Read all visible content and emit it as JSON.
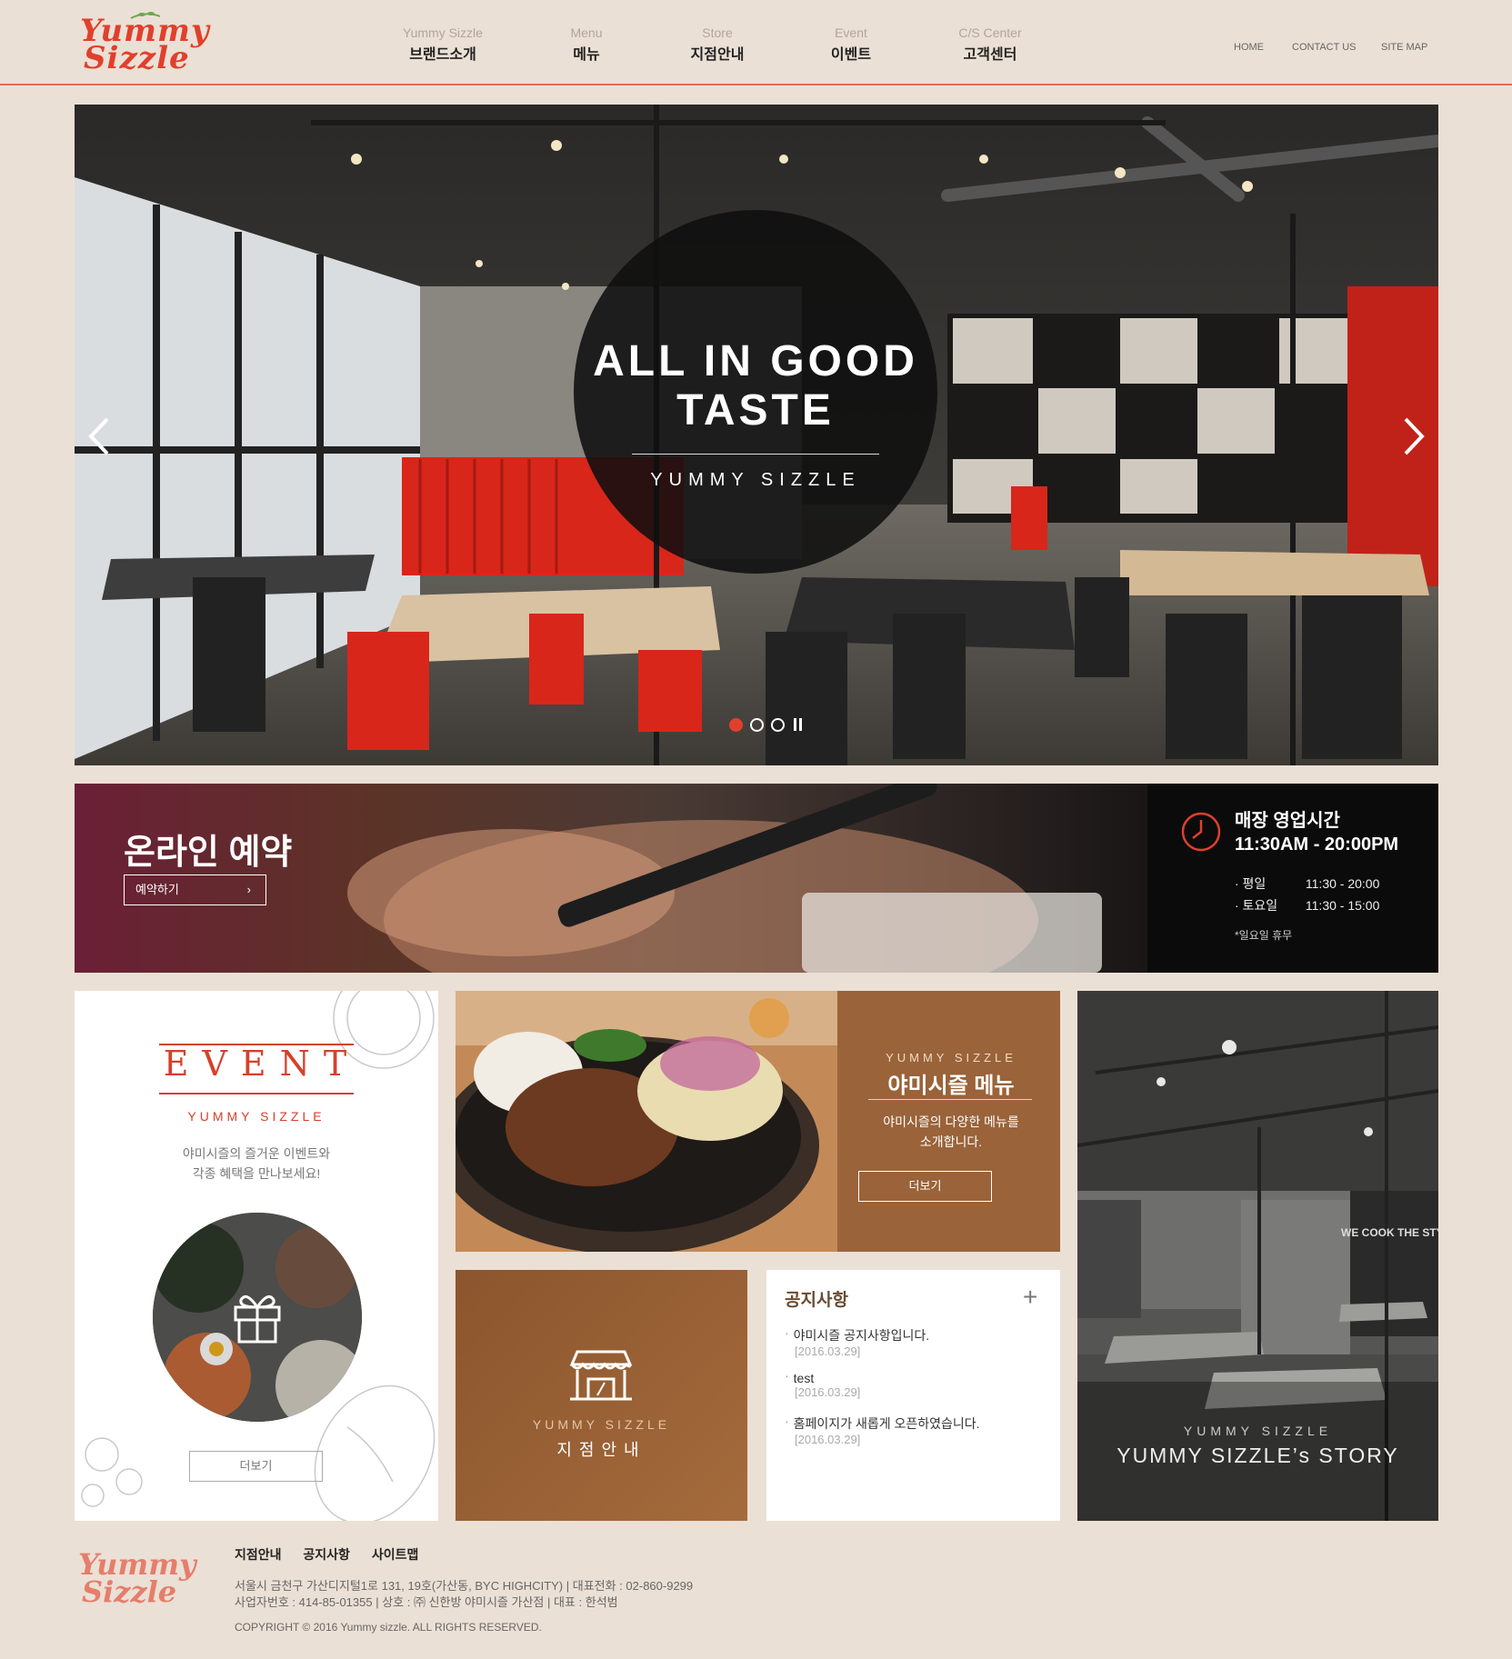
{
  "header": {
    "logo_line1": "Yummy",
    "logo_line2": "Sizzle",
    "nav": [
      {
        "en": "Yummy Sizzle",
        "ko": "브랜드소개"
      },
      {
        "en": "Menu",
        "ko": "메뉴"
      },
      {
        "en": "Store",
        "ko": "지점안내"
      },
      {
        "en": "Event",
        "ko": "이벤트"
      },
      {
        "en": "C/S Center",
        "ko": "고객센터"
      }
    ],
    "util": [
      "HOME",
      "CONTACT US",
      "SITE MAP"
    ]
  },
  "hero": {
    "title_line1": "ALL IN GOOD",
    "title_line2": "TASTE",
    "subtitle": "YUMMY SIZZLE",
    "slide_count": 3,
    "active_slide": 1
  },
  "reservation": {
    "title": "온라인 예약",
    "button": "예약하기",
    "chevron": "›",
    "hours_title": "매장 영업시간",
    "hours_range": "11:30AM - 20:00PM",
    "rows": [
      {
        "day": "· 평일",
        "time": "11:30 - 20:00"
      },
      {
        "day": "· 토요일",
        "time": "11:30 - 15:00"
      }
    ],
    "note": "*일요일 휴무"
  },
  "event": {
    "title": "EVENT",
    "subtitle": "YUMMY SIZZLE",
    "desc_line1": "야미시즐의 즐거운 이벤트와",
    "desc_line2": "각종 혜택을 만나보세요!",
    "more": "더보기"
  },
  "menu_card": {
    "en": "YUMMY SIZZLE",
    "ko": "야미시즐 메뉴",
    "desc_line1": "야미시즐의 다양한 메뉴를",
    "desc_line2": "소개합니다.",
    "more": "더보기"
  },
  "store": {
    "en": "YUMMY SIZZLE",
    "ko": "지점안내"
  },
  "notice": {
    "title": "공지사항",
    "plus": "+",
    "items": [
      {
        "title": "야미시즐 공지사항입니다.",
        "date": "[2016.03.29]"
      },
      {
        "title": "test",
        "date": "[2016.03.29]"
      },
      {
        "title": "홈페이지가 새롭게 오픈하였습니다.",
        "date": "[2016.03.29]"
      }
    ]
  },
  "story": {
    "en": "YUMMY SIZZLE",
    "title": "YUMMY SIZZLE’s STORY",
    "sign": "WE COOK THE STYLE"
  },
  "footer": {
    "logo_line1": "Yummy",
    "logo_line2": "Sizzle",
    "links": [
      "지점안내",
      "공지사항",
      "사이트맵"
    ],
    "address": "서울시 금천구 가산디지털1로 131, 19호(가산동, BYC HIGHCITY)  |  대표전화 : 02-860-9299",
    "business": "사업자번호 : 414-85-01355  |  상호 : ㈜ 신한방 야미시즐 가산점  |  대표 : 한석범",
    "copyright": "COPYRIGHT © 2016 Yummy sizzle. ALL RIGHTS RESERVED."
  },
  "colors": {
    "page_bg": "#ebe0d5",
    "accent_red": "#e0402c",
    "brown": "#9a6339",
    "dark": "#0c0b0b"
  },
  "icons": [
    "leaf-icon",
    "chevron-left-icon",
    "chevron-right-icon",
    "pause-icon",
    "clock-icon",
    "gift-icon",
    "store-icon",
    "plus-icon"
  ]
}
